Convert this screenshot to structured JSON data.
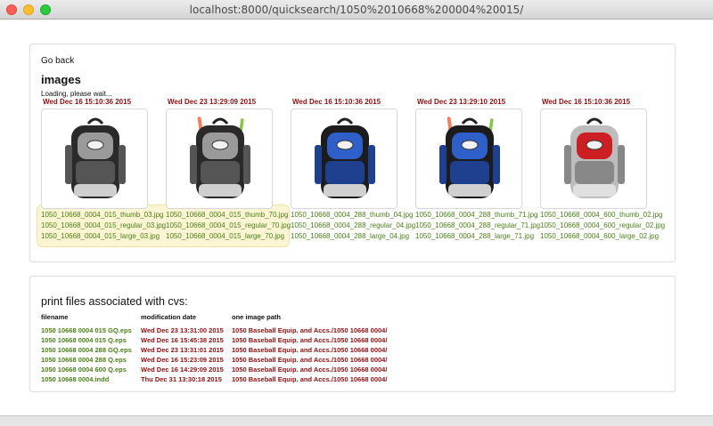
{
  "window": {
    "title": "localhost:8000/quicksearch/1050%2010668%200004%20015/"
  },
  "nav": {
    "go_back": "Go back"
  },
  "images_section": {
    "heading": "images",
    "loading_text": "Loading, please wait...",
    "items": [
      {
        "date": "Wed Dec 16 15:10:36 2015",
        "colorway": "black-gray",
        "bats": false,
        "files": [
          "1050_10668_0004_015_thumb_03.jpg",
          "1050_10668_0004_015_regular_03.jpg",
          "1050_10668_0004_015_large_03.jpg"
        ]
      },
      {
        "date": "Wed Dec 23 13:29:09 2015",
        "colorway": "black-gray",
        "bats": true,
        "files": [
          "1050_10668_0004_015_thumb_70.jpg",
          "1050_10668_0004_015_regular_70.jpg",
          "1050_10668_0004_015_large_70.jpg"
        ]
      },
      {
        "date": "Wed Dec 16 15:10:36 2015",
        "colorway": "blue-black",
        "bats": false,
        "files": [
          "1050_10668_0004_288_thumb_04.jpg",
          "1050_10668_0004_288_regular_04.jpg",
          "1050_10668_0004_288_large_04.jpg"
        ]
      },
      {
        "date": "Wed Dec 23 13:29:10 2015",
        "colorway": "blue-black",
        "bats": true,
        "files": [
          "1050_10668_0004_288_thumb_71.jpg",
          "1050_10668_0004_288_regular_71.jpg",
          "1050_10668_0004_288_large_71.jpg"
        ]
      },
      {
        "date": "Wed Dec 16 15:10:36 2015",
        "colorway": "red-gray",
        "bats": false,
        "files": [
          "1050_10668_0004_600_thumb_02.jpg",
          "1050_10668_0004_600_regular_02.jpg",
          "1050_10668_0004_600_large_02.jpg"
        ]
      }
    ]
  },
  "print_files": {
    "heading": "print files associated with cvs:",
    "columns": [
      "filename",
      "modification date",
      "one image path"
    ],
    "rows": [
      [
        "1050 10668 0004 015 GQ.eps",
        "Wed Dec 23 13:31:00 2015",
        "1050 Baseball Equip. and Accs./1050 10668 0004/"
      ],
      [
        "1050 10668 0004 015 Q.eps",
        "Wed Dec 16 15:45:38 2015",
        "1050 Baseball Equip. and Accs./1050 10668 0004/"
      ],
      [
        "1050 10668 0004 288 GQ.eps",
        "Wed Dec 23 13:31:01 2015",
        "1050 Baseball Equip. and Accs./1050 10668 0004/"
      ],
      [
        "1050 10668 0004 288 Q.eps",
        "Wed Dec 16 15:23:09 2015",
        "1050 Baseball Equip. and Accs./1050 10668 0004/"
      ],
      [
        "1050 10668 0004 600 Q.eps",
        "Wed Dec 16 14:29:09 2015",
        "1050 Baseball Equip. and Accs./1050 10668 0004/"
      ],
      [
        "1050 10668 0004.indd",
        "Thu Dec 31 13:30:18 2015",
        "1050 Baseball Equip. and Accs./1050 10668 0004/"
      ]
    ]
  },
  "colors": {
    "date_red": "#8b1010",
    "file_green": "#4a7f19",
    "highlight": "#fbf5d3"
  }
}
